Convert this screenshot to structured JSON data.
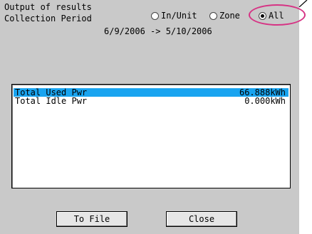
{
  "header": {
    "output_label": "Output of results",
    "collection_label": "Collection Period",
    "period": "6/9/2006 -> 5/10/2006"
  },
  "output_options": {
    "in_unit": "In/Unit",
    "zone": "Zone",
    "all": "All",
    "selected": "All"
  },
  "results": [
    {
      "name": "Total Used Pwr",
      "value": "66.888kWh",
      "selected": true
    },
    {
      "name": "Total Idle Pwr",
      "value": "0.000kWh",
      "selected": false
    }
  ],
  "buttons": {
    "to_file": "To File",
    "close": "Close"
  },
  "colors": {
    "panel": "#c9c9c9",
    "selection": "#19a4f0",
    "annotation": "#d63384"
  }
}
